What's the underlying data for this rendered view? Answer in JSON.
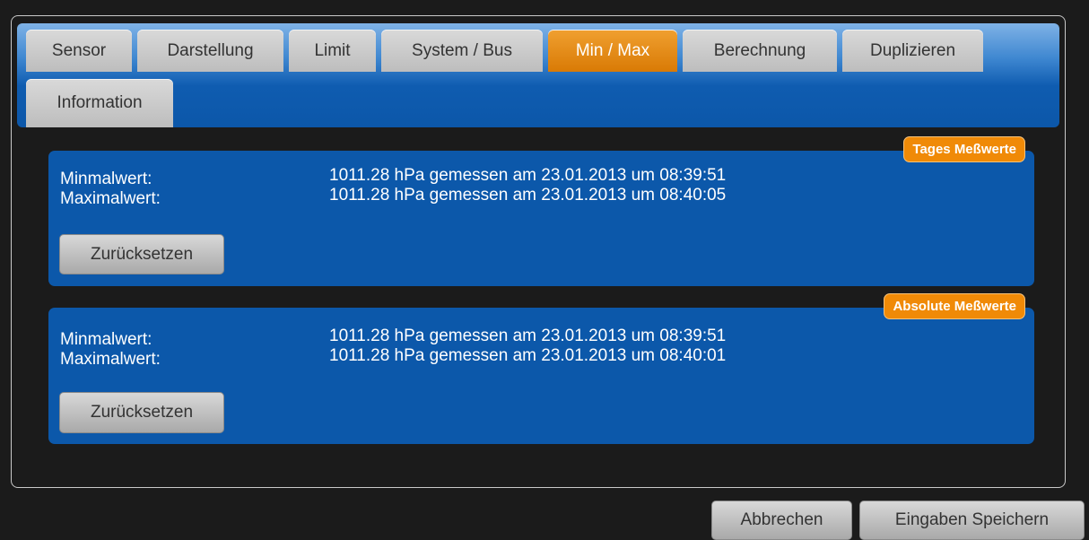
{
  "tabs": [
    {
      "label": "Sensor"
    },
    {
      "label": "Darstellung"
    },
    {
      "label": "Limit"
    },
    {
      "label": "System / Bus"
    },
    {
      "label": "Min / Max",
      "active": true
    },
    {
      "label": "Berechnung"
    },
    {
      "label": "Duplizieren"
    },
    {
      "label": "Information"
    }
  ],
  "panels": {
    "daily": {
      "badge": "Tages Meßwerte",
      "min_label": "Minmalwert:",
      "min_value": "1011.28 hPa gemessen am 23.01.2013 um 08:39:51",
      "max_label": "Maximalwert:",
      "max_value": "1011.28 hPa gemessen am 23.01.2013 um 08:40:05",
      "reset_label": "Zurücksetzen"
    },
    "absolute": {
      "badge": "Absolute Meßwerte",
      "min_label": "Minmalwert:",
      "min_value": "1011.28 hPa gemessen am 23.01.2013 um 08:39:51",
      "max_label": "Maximalwert:",
      "max_value": "1011.28 hPa gemessen am 23.01.2013 um 08:40:01",
      "reset_label": "Zurücksetzen"
    }
  },
  "footer": {
    "cancel_label": "Abbrechen",
    "save_label": "Eingaben Speichern"
  },
  "colors": {
    "accent_orange": "#f08a07",
    "panel_blue": "#0c58aa",
    "tab_gray": "#c9c9c9",
    "background": "#1b1b1b"
  }
}
